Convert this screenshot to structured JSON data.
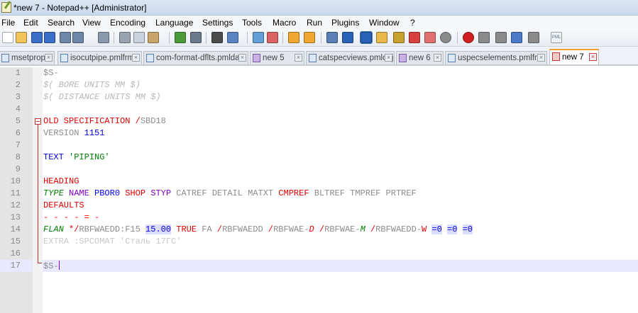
{
  "window": {
    "title": "*new 7 - Notepad++ [Administrator]"
  },
  "menu": [
    "File",
    "Edit",
    "Search",
    "View",
    "Encoding",
    "Language",
    "Settings",
    "Tools",
    "Macro",
    "Run",
    "Plugins",
    "Window",
    "?"
  ],
  "toolbar": {
    "buttons": [
      {
        "name": "new-file-icon",
        "color": "#ffffff"
      },
      {
        "name": "open-file-icon",
        "color": "#f2c45a"
      },
      {
        "name": "save-icon",
        "color": "#3b6ec8"
      },
      {
        "name": "save-all-icon",
        "color": "#3b6ec8"
      },
      {
        "name": "close-icon",
        "color": "#6e86a8"
      },
      {
        "name": "close-all-icon",
        "color": "#6e86a8"
      },
      {
        "name": "print-icon",
        "color": "#8a98ab"
      },
      {
        "name": "cut-icon",
        "color": "#9aa3ae"
      },
      {
        "name": "copy-icon",
        "color": "#c9d3df"
      },
      {
        "name": "paste-icon",
        "color": "#c9a46a"
      },
      {
        "name": "undo-icon",
        "color": "#4a9a3a"
      },
      {
        "name": "redo-icon",
        "color": "#6a7a8a"
      },
      {
        "name": "find-icon",
        "color": "#4b4b4b"
      },
      {
        "name": "replace-icon",
        "color": "#5b84c4"
      },
      {
        "name": "zoom-in-icon",
        "color": "#63a0d8"
      },
      {
        "name": "zoom-out-icon",
        "color": "#d86363"
      },
      {
        "name": "sync-vertical-icon",
        "color": "#f0a830"
      },
      {
        "name": "sync-horizontal-icon",
        "color": "#f0a830"
      },
      {
        "name": "word-wrap-icon",
        "color": "#5a7fb4"
      },
      {
        "name": "show-all-chars-icon",
        "color": "#2a62b8"
      },
      {
        "name": "indent-guide-icon",
        "color": "#2a62b8"
      },
      {
        "name": "doc-map-icon",
        "color": "#e8b84a"
      },
      {
        "name": "function-list-icon",
        "color": "#c8a030"
      },
      {
        "name": "folder-workspace-icon",
        "color": "#d84040"
      },
      {
        "name": "folder-as-workspace-icon",
        "color": "#e07070"
      },
      {
        "name": "monitoring-icon",
        "color": "#8a8a8a"
      },
      {
        "name": "record-macro-icon",
        "color": "#d02020"
      },
      {
        "name": "stop-macro-icon",
        "color": "#8a8a8a"
      },
      {
        "name": "play-macro-icon",
        "color": "#8a8a8a"
      },
      {
        "name": "play-multiple-icon",
        "color": "#4a7ac8"
      },
      {
        "name": "save-macro-icon",
        "color": "#8a8a8a"
      },
      {
        "name": "pml-icon",
        "color": "#5a6a80"
      }
    ],
    "pml_label": "PML"
  },
  "tabs": [
    {
      "label": "msetprop",
      "icon": "blue",
      "active": false
    },
    {
      "label": "isocutpipe.pmlfrm",
      "icon": "blue",
      "active": false
    },
    {
      "label": "com-format-dflts.pmldat",
      "icon": "blue",
      "active": false
    },
    {
      "label": "new 5",
      "icon": "purple",
      "active": false
    },
    {
      "label": "catspecviews.pmlobj",
      "icon": "blue",
      "active": false
    },
    {
      "label": "new 6",
      "icon": "purple",
      "active": false
    },
    {
      "label": "uspecselements.pmlfrm",
      "icon": "blue",
      "active": false
    },
    {
      "label": "new 7",
      "icon": "red",
      "active": true
    }
  ],
  "editor": {
    "current_line": 17,
    "lines": [
      {
        "n": "1",
        "tokens": [
          {
            "t": "$S-",
            "c": "gray"
          }
        ]
      },
      {
        "n": "2",
        "tokens": [
          {
            "t": "$( BORE UNITS MM $)",
            "c": "comment"
          }
        ]
      },
      {
        "n": "3",
        "tokens": [
          {
            "t": "$( DISTANCE UNITS MM $)",
            "c": "comment"
          }
        ]
      },
      {
        "n": "4",
        "tokens": []
      },
      {
        "n": "5",
        "tokens": [
          {
            "t": "OLD SPECIFICATION ",
            "c": "red"
          },
          {
            "t": "/",
            "c": "red"
          },
          {
            "t": "SBD18",
            "c": "gray"
          }
        ]
      },
      {
        "n": "6",
        "tokens": [
          {
            "t": "VERSION ",
            "c": "gray"
          },
          {
            "t": "1151",
            "c": "blue"
          }
        ]
      },
      {
        "n": "7",
        "tokens": []
      },
      {
        "n": "8",
        "tokens": [
          {
            "t": "TEXT ",
            "c": "blue"
          },
          {
            "t": "'PIPING'",
            "c": "green"
          }
        ]
      },
      {
        "n": "9",
        "tokens": []
      },
      {
        "n": "10",
        "tokens": [
          {
            "t": "HEADING",
            "c": "red"
          }
        ]
      },
      {
        "n": "11",
        "tokens": [
          {
            "t": "TYPE ",
            "c": "greeni"
          },
          {
            "t": "NAME ",
            "c": "purple"
          },
          {
            "t": "PBOR0 ",
            "c": "blue"
          },
          {
            "t": "SHOP ",
            "c": "red"
          },
          {
            "t": "STYP ",
            "c": "purple"
          },
          {
            "t": "CATREF DETAIL MATXT ",
            "c": "gray"
          },
          {
            "t": "CMPREF ",
            "c": "red"
          },
          {
            "t": "BLTREF TMPREF PRTREF",
            "c": "gray"
          }
        ]
      },
      {
        "n": "12",
        "tokens": [
          {
            "t": "DEFAULTS",
            "c": "red"
          }
        ]
      },
      {
        "n": "13",
        "tokens": [
          {
            "t": "- - - - = -",
            "c": "sep"
          }
        ]
      },
      {
        "n": "14",
        "tokens": [
          {
            "t": "FLAN ",
            "c": "greeni"
          },
          {
            "t": "*/",
            "c": "red"
          },
          {
            "t": "RBFWAEDD:F15 ",
            "c": "gray"
          },
          {
            "t": "15.00",
            "c": "num"
          },
          {
            "t": " ",
            "c": "default"
          },
          {
            "t": "TRUE ",
            "c": "red"
          },
          {
            "t": "FA ",
            "c": "gray"
          },
          {
            "t": "/",
            "c": "red"
          },
          {
            "t": "RBFWAEDD ",
            "c": "gray"
          },
          {
            "t": "/",
            "c": "red"
          },
          {
            "t": "RBFWAE-",
            "c": "gray"
          },
          {
            "t": "D",
            "c": "redi"
          },
          {
            "t": " ",
            "c": "default"
          },
          {
            "t": "/",
            "c": "red"
          },
          {
            "t": "RBFWAE-",
            "c": "gray"
          },
          {
            "t": "M",
            "c": "greeni"
          },
          {
            "t": " ",
            "c": "default"
          },
          {
            "t": "/",
            "c": "red"
          },
          {
            "t": "RBFWAEDD-",
            "c": "gray"
          },
          {
            "t": "W",
            "c": "red"
          },
          {
            "t": " ",
            "c": "default"
          },
          {
            "t": "=0",
            "c": "num"
          },
          {
            "t": " ",
            "c": "default"
          },
          {
            "t": "=0",
            "c": "num"
          },
          {
            "t": " ",
            "c": "default"
          },
          {
            "t": "=0",
            "c": "num"
          }
        ]
      },
      {
        "n": "15",
        "tokens": [
          {
            "t": "EXTRA :SPCOMAT 'Сталь 17ГС'",
            "c": "comment-up"
          }
        ]
      },
      {
        "n": "16",
        "tokens": []
      },
      {
        "n": "17",
        "tokens": [
          {
            "t": "$S-",
            "c": "gray"
          }
        ]
      }
    ]
  }
}
